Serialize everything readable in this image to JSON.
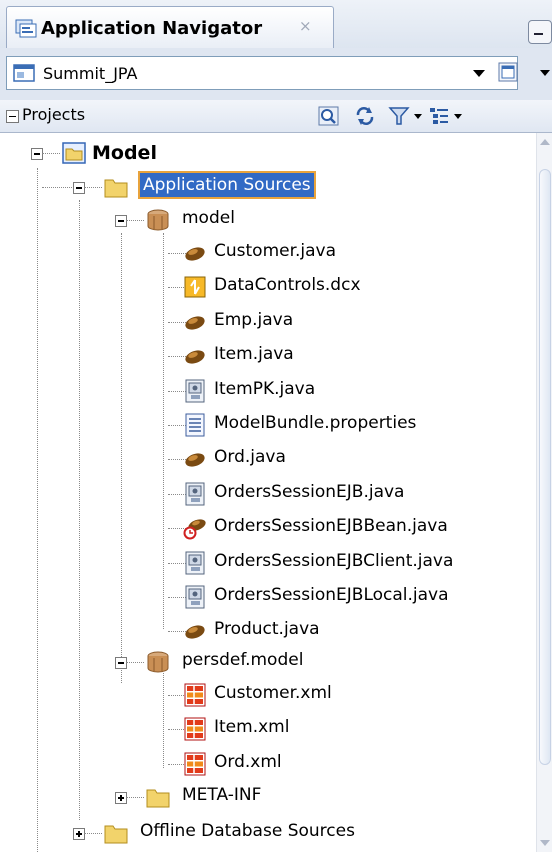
{
  "window": {
    "tab_title": "Application Navigator",
    "tab_close_glyph": "×",
    "tab_icon": "application-navigator-icon"
  },
  "chooser": {
    "selected_application": "Summit_JPA",
    "icon": "application-icon"
  },
  "projects_bar": {
    "label": "Projects",
    "toolbar_icons": [
      "zoom-icon",
      "refresh-icon",
      "filter-icon",
      "view-options-icon"
    ]
  },
  "tree": {
    "project": "Model",
    "application_sources": "Application Sources",
    "packages": {
      "model": {
        "label": "model",
        "files": [
          {
            "name": "Customer.java",
            "icon": "entity-bean-icon"
          },
          {
            "name": "DataControls.dcx",
            "icon": "data-control-icon"
          },
          {
            "name": "Emp.java",
            "icon": "entity-bean-icon"
          },
          {
            "name": "Item.java",
            "icon": "entity-bean-icon"
          },
          {
            "name": "ItemPK.java",
            "icon": "java-class-icon"
          },
          {
            "name": "ModelBundle.properties",
            "icon": "properties-file-icon"
          },
          {
            "name": "Ord.java",
            "icon": "entity-bean-icon"
          },
          {
            "name": "OrdersSessionEJB.java",
            "icon": "java-class-icon"
          },
          {
            "name": "OrdersSessionEJBBean.java",
            "icon": "session-bean-icon"
          },
          {
            "name": "OrdersSessionEJBClient.java",
            "icon": "java-class-icon"
          },
          {
            "name": "OrdersSessionEJBLocal.java",
            "icon": "java-class-icon"
          },
          {
            "name": "Product.java",
            "icon": "entity-bean-icon"
          }
        ]
      },
      "persdef": {
        "label": "persdef.model",
        "files": [
          {
            "name": "Customer.xml",
            "icon": "xml-mapping-icon"
          },
          {
            "name": "Item.xml",
            "icon": "xml-mapping-icon"
          },
          {
            "name": "Ord.xml",
            "icon": "xml-mapping-icon"
          }
        ]
      }
    },
    "meta_inf": "META-INF",
    "offline_db": "Offline Database Sources"
  },
  "colors": {
    "selection": "#316ac5",
    "selection_border": "#e8a33c",
    "folder": "#f2d36b"
  }
}
